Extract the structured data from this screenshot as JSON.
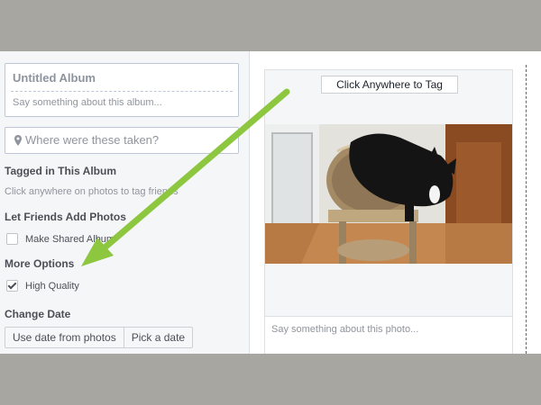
{
  "album": {
    "title": "Untitled Album",
    "description_placeholder": "Say something about this album..."
  },
  "location": {
    "placeholder": "Where were these taken?",
    "icon": "map-pin-icon"
  },
  "tagged": {
    "title": "Tagged in This Album",
    "hint": "Click anywhere on photos to tag friends"
  },
  "friends": {
    "title": "Let Friends Add Photos",
    "checkbox_label": "Make Shared Album",
    "checked": false
  },
  "more_options": {
    "title": "More Options",
    "checkbox_label": "High Quality",
    "checked": true
  },
  "change_date": {
    "title": "Change Date",
    "buttons": [
      "Use date from photos",
      "Pick a date"
    ]
  },
  "photo_card": {
    "tag_button": "Click Anywhere to Tag",
    "description_placeholder": "Say something about this photo..."
  },
  "colors": {
    "arrow": "#8dc63f",
    "input_border": "#bdc7d8",
    "dashed_border": "#4267b2"
  }
}
